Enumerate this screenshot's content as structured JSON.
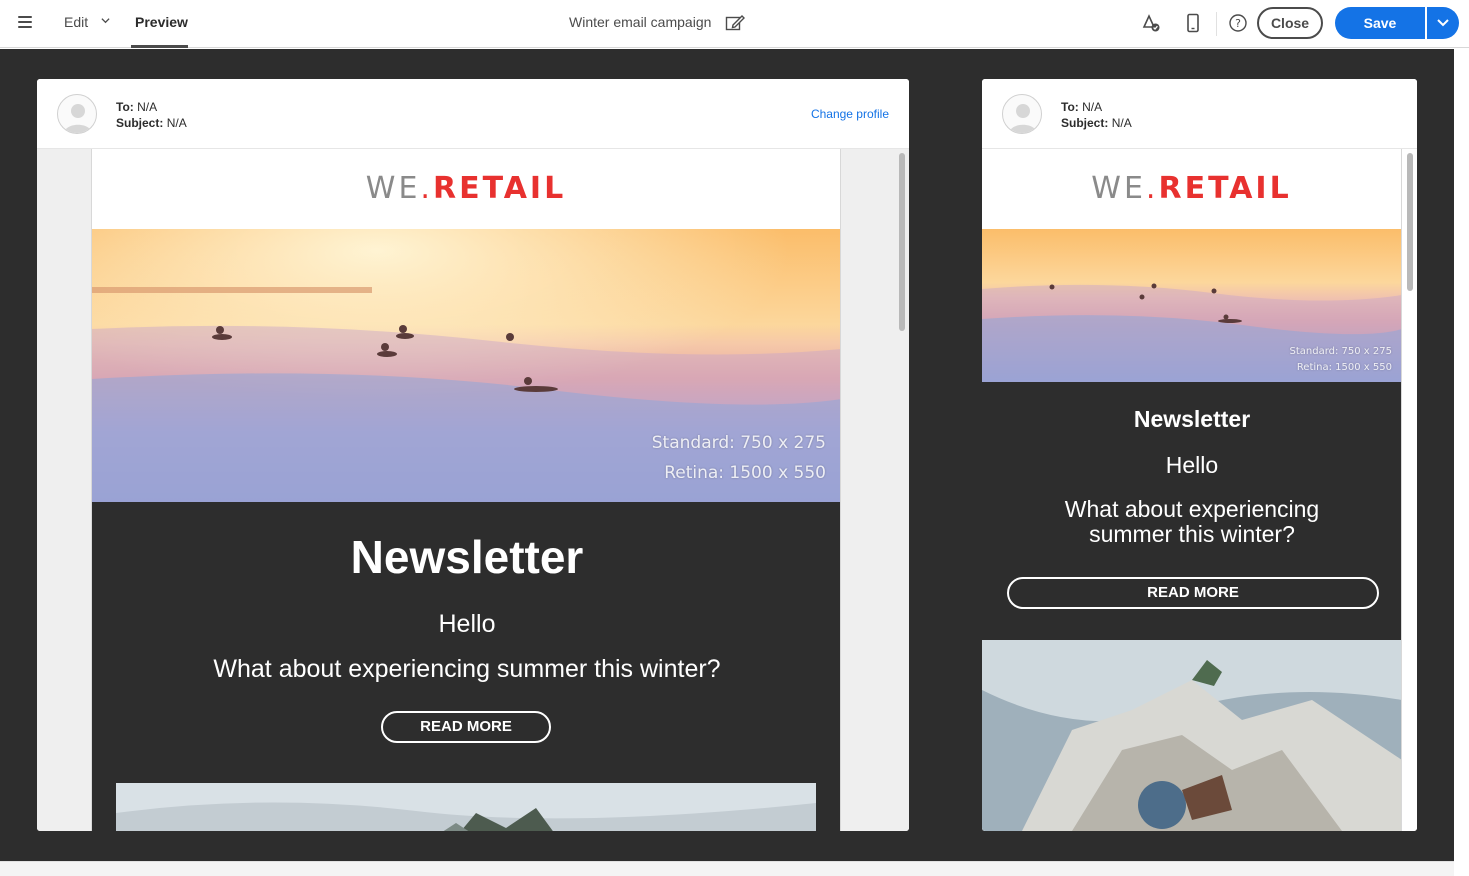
{
  "toolbar": {
    "menu_icon": "hamburger-icon",
    "edit_label": "Edit",
    "preview_label": "Preview",
    "title": "Winter email campaign",
    "close_label": "Close",
    "save_label": "Save"
  },
  "icons": {
    "personalize": "paint-check-icon",
    "mobile": "mobile-device-icon",
    "help": "help-icon",
    "edit_title": "pencil-edit-icon",
    "chevron": "chevron-down-icon"
  },
  "colors": {
    "accent": "#1473e6",
    "brand_red": "#e8312f",
    "workspace_bg": "#2d2d2d"
  },
  "desktop_preview": {
    "to": "N/A",
    "subject": "N/A",
    "to_label": "To:",
    "subject_label": "Subject:",
    "change_profile": "Change profile",
    "email": {
      "logo_we": "WE",
      "logo_dot": ".",
      "logo_retail": "RETAIL",
      "hero_caption_line1": "Standard: 750 x 275",
      "hero_caption_line2": "Retina: 1500 x 550",
      "newsletter": "Newsletter",
      "hello": "Hello",
      "question": "What about experiencing summer this winter?",
      "cta": "READ MORE"
    }
  },
  "mobile_preview": {
    "to": "N/A",
    "subject": "N/A",
    "to_label": "To:",
    "subject_label": "Subject:",
    "email": {
      "logo_we": "WE",
      "logo_dot": ".",
      "logo_retail": "RETAIL",
      "hero_caption_line1": "Standard: 750 x 275",
      "hero_caption_line2": "Retina: 1500 x 550",
      "newsletter": "Newsletter",
      "hello": "Hello",
      "question_line1": "What about experiencing",
      "question_line2": "summer this winter?",
      "cta": "READ MORE"
    }
  }
}
